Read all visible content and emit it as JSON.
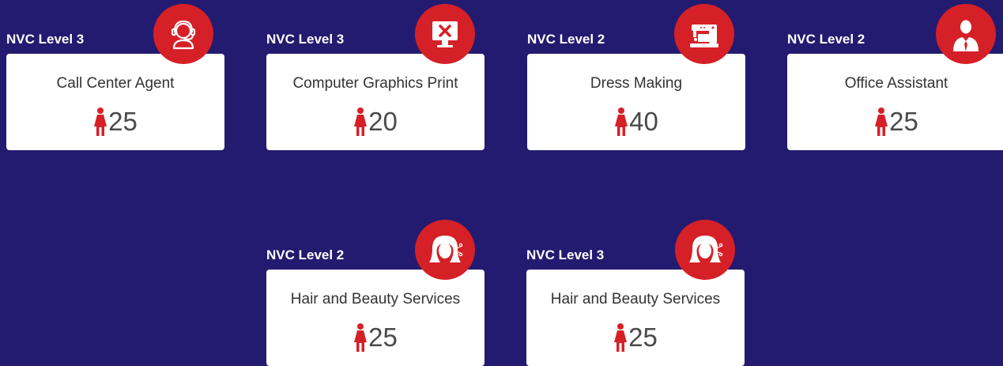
{
  "courses": [
    {
      "level": "NVC Level 3",
      "title": "Call Center Agent",
      "count": "25",
      "icon": "headset-agent-icon"
    },
    {
      "level": "NVC Level 3",
      "title": "Computer Graphics Print",
      "count": "20",
      "icon": "computer-monitor-icon"
    },
    {
      "level": "NVC Level 2",
      "title": "Dress Making",
      "count": "40",
      "icon": "sewing-machine-icon"
    },
    {
      "level": "NVC Level 2",
      "title": "Office Assistant",
      "count": "25",
      "icon": "office-person-icon"
    },
    {
      "level": "NVC Level 2",
      "title": "Hair and Beauty Services",
      "count": "25",
      "icon": "hair-scissors-icon"
    },
    {
      "level": "NVC Level 3",
      "title": "Hair and Beauty Services",
      "count": "25",
      "icon": "hair-scissors-icon"
    }
  ],
  "colors": {
    "background": "#231b6f",
    "accent": "#d62027",
    "card": "#ffffff",
    "text": "#333333"
  }
}
